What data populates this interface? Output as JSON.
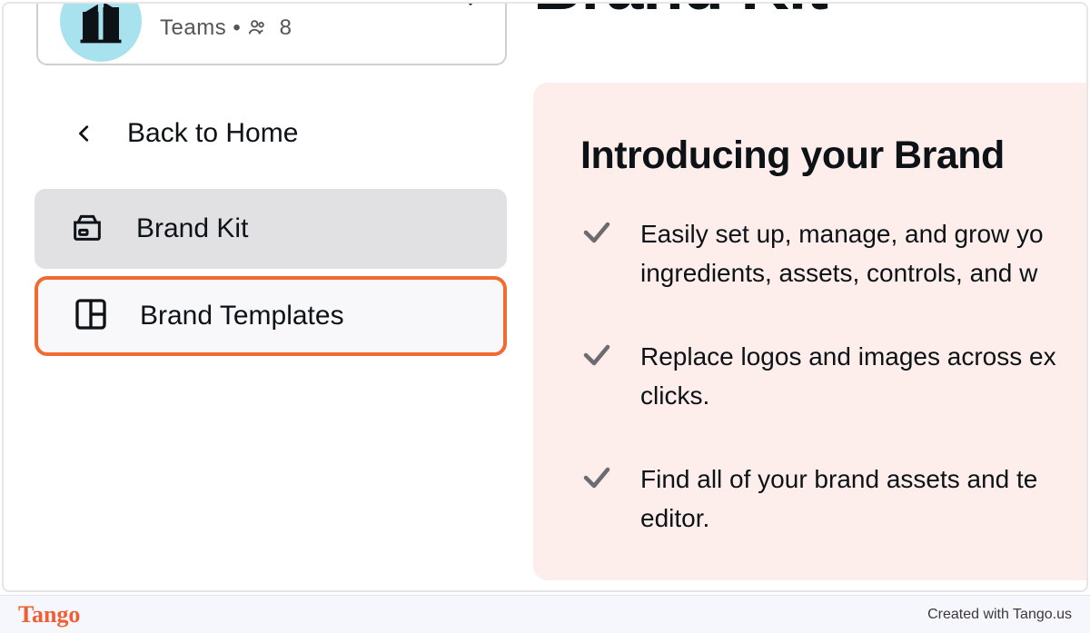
{
  "team": {
    "subtitle": "Teams • ",
    "member_count": "8"
  },
  "nav": {
    "back_label": "Back to Home",
    "brand_kit_label": "Brand Kit",
    "brand_templates_label": "Brand Templates"
  },
  "page": {
    "title": "Brand Kit"
  },
  "intro": {
    "title": "Introducing your Brand",
    "items": [
      "Easily set up, manage, and grow yo\ningredients, assets, controls, and w",
      "Replace logos and images across ex\nclicks.",
      "Find all of your brand assets and te\neditor."
    ]
  },
  "footer": {
    "logo": "Tango",
    "credit": "Created with Tango.us"
  }
}
